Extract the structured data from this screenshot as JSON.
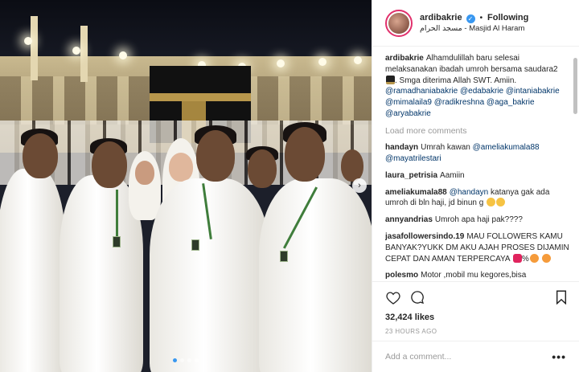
{
  "post": {
    "username": "ardibakrie",
    "verified_icon": "verified-badge-icon",
    "separator": "•",
    "follow_label": "Following",
    "location": "مسجد الحرام - Masjid Al Haram"
  },
  "caption": {
    "user": "ardibakrie",
    "text": "Alhamdulillah baru selesai melaksanakan ibadah umroh bersama saudara2",
    "text2": ". Smga diterima Allah SWT. Amiin.",
    "mentions": [
      "@ramadhaniabakrie",
      "@edabakrie",
      "@intaniabakrie",
      "@mimalaila9",
      "@radikreshna",
      "@aga_bakrie",
      "@aryabakrie"
    ]
  },
  "load_more_label": "Load more comments",
  "comments": [
    {
      "user": "handayn",
      "text": "Umrah kawan",
      "mentions": [
        "@ameliakumala88",
        "@mayatrilestari"
      ]
    },
    {
      "user": "laura_petrisia",
      "text": "Aamiin"
    },
    {
      "user": "ameliakumala88",
      "mention": "@handayn",
      "text": "katanya gak ada umroh di bln haji, jd binun g"
    },
    {
      "user": "annyandrias",
      "text": "Umroh apa haji pak????"
    },
    {
      "user": "jasafollowersindo.19",
      "text": "MAU FOLLOWERS KAMU BANYAK?YUKK DM AKU AJAH PROSES DIJAMIN CEPAT DAN AMAN TERPERCAYA",
      "text_mid": "%"
    },
    {
      "user": "polesmo",
      "text": "Motor ,mobil mu kegores,bisa"
    }
  ],
  "actions": {
    "like_icon": "heart-icon",
    "comment_icon": "comment-icon",
    "save_icon": "bookmark-icon"
  },
  "likes": "32,424 likes",
  "time_ago": "23 HOURS AGO",
  "add_comment": {
    "placeholder": "Add a comment...",
    "more_label": "•••"
  },
  "carousel": {
    "dot_count": 4,
    "active_index": 0,
    "next_icon": "chevron-right-icon"
  },
  "colors": {
    "accent": "#3897f0",
    "mention": "#003569",
    "muted": "#999999",
    "story_ring": "#e1306c"
  }
}
